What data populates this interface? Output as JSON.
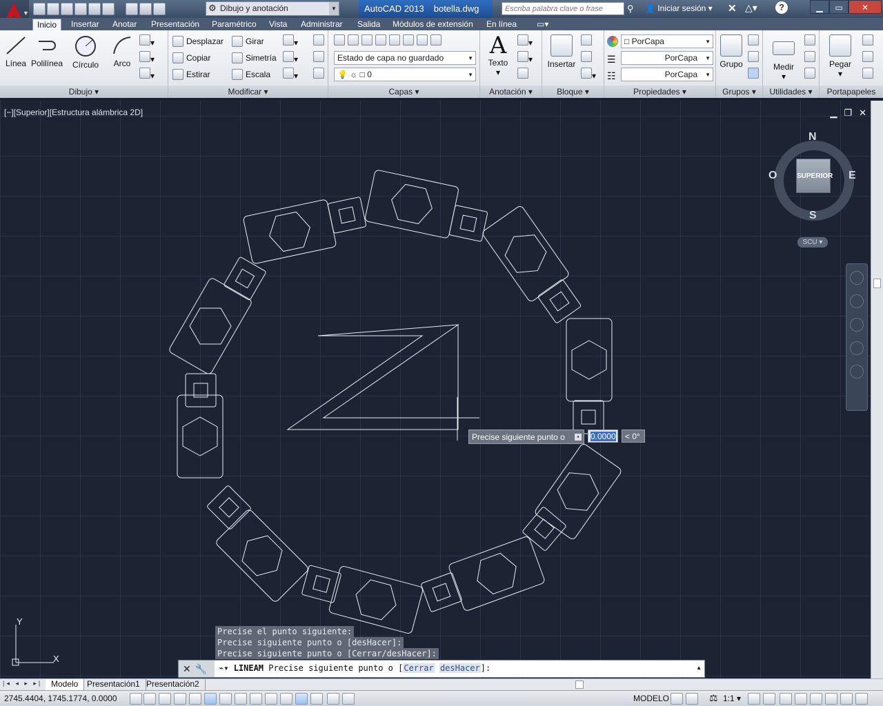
{
  "window": {
    "workspace": "Dibujo y anotación",
    "app_title": "AutoCAD 2013",
    "file_name": "botella.dwg",
    "search_placeholder": "Escriba palabra clave o frase",
    "signin": "Iniciar sesión"
  },
  "ribbon_tabs": [
    "Inicio",
    "Insertar",
    "Anotar",
    "Presentación",
    "Paramétrico",
    "Vista",
    "Administrar",
    "Salida",
    "Módulos de extensión",
    "En línea"
  ],
  "ribbon": {
    "dibujo": {
      "label": "Dibujo",
      "linea": "Línea",
      "polilinea": "Polilínea",
      "circulo": "Círculo",
      "arco": "Arco"
    },
    "modificar": {
      "label": "Modificar",
      "desplazar": "Desplazar",
      "girar": "Girar",
      "copiar": "Copiar",
      "simetria": "Simetría",
      "estirar": "Estirar",
      "escala": "Escala"
    },
    "capas": {
      "label": "Capas",
      "layer_state": "Estado de capa no guardado",
      "current_layer": "0"
    },
    "anotacion": {
      "label": "Anotación",
      "texto": "Texto"
    },
    "bloque": {
      "label": "Bloque",
      "insertar": "Insertar"
    },
    "propiedades": {
      "label": "Propiedades",
      "color": "PorCapa",
      "linetype": "PorCapa",
      "lineweight": "PorCapa"
    },
    "grupos": {
      "label": "Grupos",
      "grupo": "Grupo"
    },
    "utilidades": {
      "label": "Utilidades",
      "medir": "Medir"
    },
    "portapapeles": {
      "label": "Portapapeles",
      "pegar": "Pegar"
    }
  },
  "viewport": {
    "label": "[−][Superior][Estructura alámbrica 2D]",
    "viewcube": {
      "north": "N",
      "south": "S",
      "east": "E",
      "west": "O",
      "face": "SUPERIOR",
      "ucs": "SCU"
    }
  },
  "tooltip": {
    "prompt": "Precise siguiente punto o",
    "value": "0.0000",
    "angle": "< 0°"
  },
  "command_history": [
    "Precise el punto siguiente:",
    "Precise siguiente punto o [desHacer]:",
    "Precise siguiente punto o [Cerrar/desHacer]:"
  ],
  "command_line": {
    "command": "LINEAM",
    "prompt": "Precise siguiente punto o [",
    "opt1": "Cerrar",
    "opt2": "desHacer",
    "suffix": "]:"
  },
  "layout_tabs": [
    "Modelo",
    "Presentación1",
    "Presentación2"
  ],
  "status": {
    "coords": "2745.4404, 1745.1774, 0.0000",
    "mode": "MODELO",
    "scale": "1:1"
  }
}
